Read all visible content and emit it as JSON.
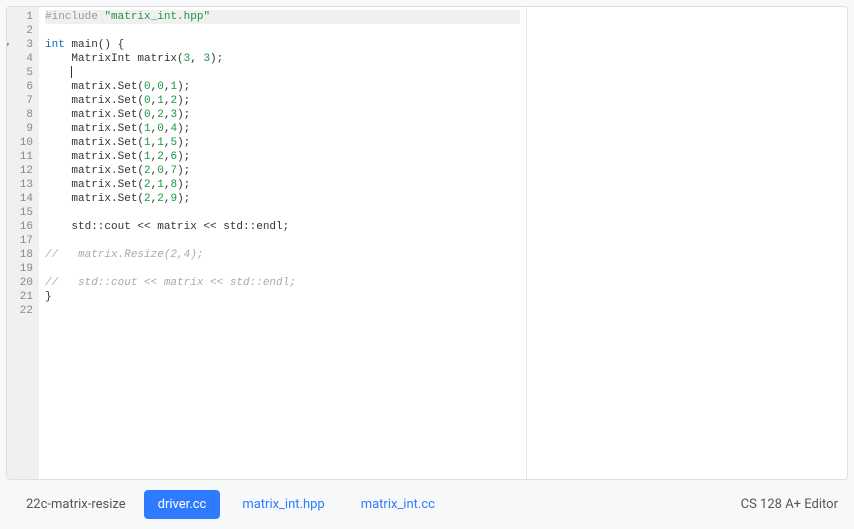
{
  "project_name": "22c-matrix-resize",
  "editor_label": "CS 128 A+ Editor",
  "tabs": [
    {
      "label": "driver.cc",
      "active": true
    },
    {
      "label": "matrix_int.hpp",
      "active": false
    },
    {
      "label": "matrix_int.cc",
      "active": false
    }
  ],
  "gutter": {
    "lines": [
      "1",
      "2",
      "3",
      "4",
      "5",
      "6",
      "7",
      "8",
      "9",
      "10",
      "11",
      "12",
      "13",
      "14",
      "15",
      "16",
      "17",
      "18",
      "19",
      "20",
      "21",
      "22"
    ],
    "fold_marker": "▾",
    "fold_line": 3
  },
  "code": {
    "l1_preproc": "#include ",
    "l1_string": "\"matrix_int.hpp\"",
    "l3_kw1": "int",
    "l3_rest": " main() {",
    "l4_indent": "    MatrixInt matrix(",
    "l4_n1": "3",
    "l4_mid": ", ",
    "l4_n2": "3",
    "l4_end": ");",
    "l5_indent": "    ",
    "l6": "    matrix.Set(",
    "l6n": [
      "0",
      "0",
      "1"
    ],
    "l7n": [
      "0",
      "1",
      "2"
    ],
    "l8n": [
      "0",
      "2",
      "3"
    ],
    "l9n": [
      "1",
      "0",
      "4"
    ],
    "l10n": [
      "1",
      "1",
      "5"
    ],
    "l11n": [
      "1",
      "2",
      "6"
    ],
    "l12n": [
      "2",
      "0",
      "7"
    ],
    "l13n": [
      "2",
      "1",
      "8"
    ],
    "l14n": [
      "2",
      "2",
      "9"
    ],
    "set_close": ");",
    "comma": ",",
    "l16": "    std::cout << matrix << std::endl;",
    "l18": "//   matrix.Resize(2,4);",
    "l20": "//   std::cout << matrix << std::endl;",
    "l21": "}"
  }
}
